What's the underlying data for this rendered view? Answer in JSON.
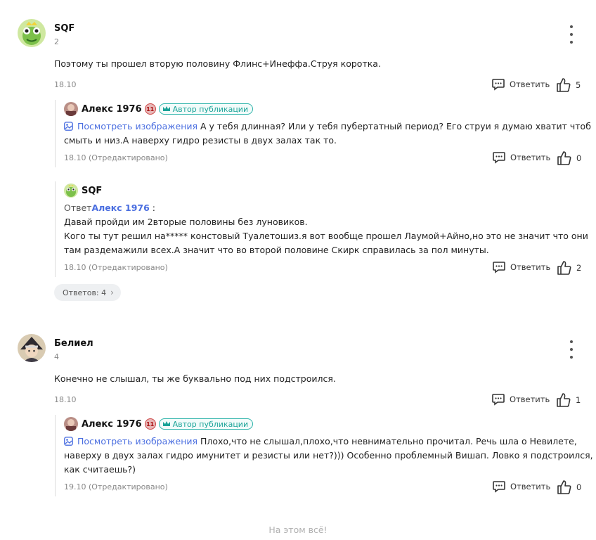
{
  "comments": [
    {
      "author": "SQF",
      "level": "2",
      "text": "Поэтому ты прошел вторую половину Флинс+Инеффа.Струя коротка.",
      "date": "18.10",
      "reply_label": "Ответить",
      "likes": "5",
      "replies_pill": "Ответов: 4",
      "replies": [
        {
          "author": "Алекс 1976",
          "level_badge": "11",
          "author_badge": "Автор публикации",
          "images_link": "Посмотреть изображения",
          "text_line1": " А у тебя длинная? Или у тебя пубертатный период? Его струи я думаю хватит чтоб",
          "text_line2": "смыть и низ.А наверху гидро резисты в двух залах так то.",
          "date": "18.10 (Отредактировано)",
          "reply_label": "Ответить",
          "likes": "0"
        },
        {
          "author": "SQF",
          "answer_prefix": "Ответ",
          "answer_to": "Алекс 1976",
          "answer_suffix": " :",
          "text_line1": "Давай пройди им 2вторые половины без луновиков.",
          "text_line2": "Кого ты тут решил на***** констовый Туалетошиз.я вот вообще прошел Лаумой+Айно,но это не значит что они",
          "text_line3": "там раздемажили всех.А значит что во второй половине Скирк справилась за пол минуты.",
          "date": "18.10 (Отредактировано)",
          "reply_label": "Ответить",
          "likes": "2"
        }
      ]
    },
    {
      "author": "Белиел",
      "level": "4",
      "text": "Конечно не слышал, ты же буквально под них подстроился.",
      "date": "18.10",
      "reply_label": "Ответить",
      "likes": "1",
      "replies": [
        {
          "author": "Алекс 1976",
          "level_badge": "11",
          "author_badge": "Автор публикации",
          "images_link": "Посмотреть изображения",
          "text_line1": " Плохо,что не слышал,плохо,что невнимательно прочитал. Речь шла о Невилете,",
          "text_line2": "наверху в двух залах гидро имунитет и резисты или нет?))) Особенно проблемный Вишап. Ловко я подстроился,",
          "text_line3": "как считаешь?)",
          "date": "19.10 (Отредактировано)",
          "reply_label": "Ответить",
          "likes": "0"
        }
      ]
    }
  ],
  "footer": "На этом всё!",
  "colors": {
    "link": "#4a6ee0",
    "badge": "#2bb3a9",
    "muted": "#888888"
  },
  "icons": [
    "frog-avatar",
    "character-avatar",
    "user-avatar",
    "kebab-icon",
    "comment-icon",
    "like-icon",
    "image-icon",
    "crown-icon",
    "chevron-right-icon"
  ]
}
